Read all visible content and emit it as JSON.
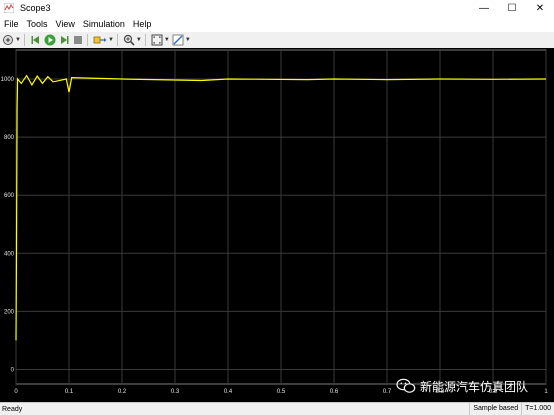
{
  "window": {
    "title": "Scope3"
  },
  "menu": [
    "File",
    "Tools",
    "View",
    "Simulation",
    "Help"
  ],
  "toolbar": {
    "buttons": [
      "settings-icon",
      "step-back-icon",
      "run-icon",
      "step-forward-icon",
      "stop-icon",
      "highlight-block-icon",
      "zoom-icon",
      "fit-axes-icon",
      "style-icon"
    ]
  },
  "chart_data": {
    "type": "line",
    "xlim": [
      0,
      1.0
    ],
    "ylim": [
      -50,
      1100
    ],
    "xticks": [
      "0",
      "0.1",
      "0.2",
      "0.3",
      "0.4",
      "0.5",
      "0.6",
      "0.7",
      "0.8",
      "0.9",
      "1"
    ],
    "yticks": [
      "0",
      "200",
      "400",
      "600",
      "800",
      "1000"
    ],
    "grid": true,
    "series": [
      {
        "color": "#ffff00",
        "points": [
          [
            0,
            100
          ],
          [
            0.001,
            420
          ],
          [
            0.002,
            900
          ],
          [
            0.003,
            1000
          ],
          [
            0.01,
            985
          ],
          [
            0.02,
            1012
          ],
          [
            0.03,
            980
          ],
          [
            0.04,
            1010
          ],
          [
            0.05,
            985
          ],
          [
            0.06,
            1008
          ],
          [
            0.07,
            990
          ],
          [
            0.095,
            1000
          ],
          [
            0.1,
            955
          ],
          [
            0.105,
            1005
          ],
          [
            0.2,
            1000
          ],
          [
            0.35,
            995
          ],
          [
            0.4,
            1000
          ],
          [
            0.55,
            998
          ],
          [
            0.6,
            1000
          ],
          [
            0.7,
            998
          ],
          [
            0.8,
            1000
          ],
          [
            0.9,
            999
          ],
          [
            1.0,
            1000
          ]
        ]
      }
    ]
  },
  "status": {
    "left": "Ready",
    "mode": "Sample based",
    "time": "T=1.000"
  },
  "watermark": {
    "text": "新能源汽车仿真团队"
  }
}
